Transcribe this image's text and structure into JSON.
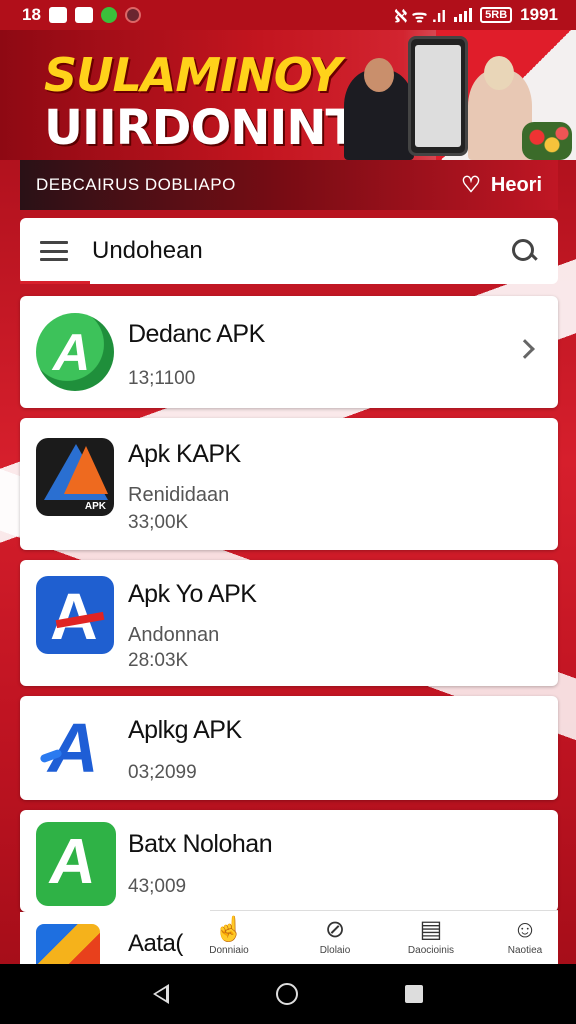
{
  "status_bar": {
    "left_time": "18",
    "right_status": "ℵ ᯤ .ıl",
    "battery": "5RB",
    "clock": "1991"
  },
  "banner": {
    "title_line1": "SULAMINOY",
    "title_line2": "UIIRDONINTA"
  },
  "subbar": {
    "text": "DEBCAIRUS DOBLIAPO",
    "favorite_label": "Heori"
  },
  "search": {
    "title": "Undohean"
  },
  "apps": [
    {
      "name": "Dedanc APK",
      "subtitle": "",
      "size": "13;1100",
      "icon": "green-play-icon"
    },
    {
      "name": "Apk KAPK",
      "subtitle": "Renididaan",
      "size": "33;00K",
      "icon": "orange-blue-a-icon",
      "tag": "APK"
    },
    {
      "name": "Apk Yo APK",
      "subtitle": "Andonnan",
      "size": "28:03K",
      "icon": "blue-red-a-icon"
    },
    {
      "name": "Aplkg APK",
      "subtitle": "",
      "size": "03;2099",
      "icon": "blue-a-icon"
    },
    {
      "name": "Batx Nolohan",
      "subtitle": "",
      "size": "43;009",
      "icon": "green-a-icon"
    },
    {
      "name": "Aata(",
      "subtitle": "",
      "size": "",
      "icon": "multicolor-icon"
    }
  ],
  "tabs": [
    {
      "label": "Donniaio",
      "icon": "hand-icon"
    },
    {
      "label": "Dlolaio",
      "icon": "compass-icon"
    },
    {
      "label": "Daocioinis",
      "icon": "list-box-icon"
    },
    {
      "label": "Naotiea",
      "icon": "person-icon"
    }
  ],
  "colors": {
    "brand_red": "#c3151f",
    "accent_yellow": "#ffd21a"
  }
}
